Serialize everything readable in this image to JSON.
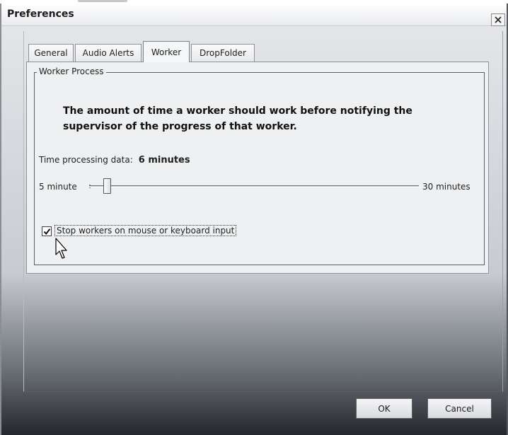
{
  "window": {
    "title": "Preferences"
  },
  "tabs": [
    {
      "label": "General",
      "active": false
    },
    {
      "label": "Audio Alerts",
      "active": false
    },
    {
      "label": "Worker",
      "active": true
    },
    {
      "label": "DropFolder",
      "active": false
    }
  ],
  "worker_process": {
    "group_label": "Worker Process",
    "description": "The amount of time a worker should work before notifying the supervisor of the progress of that worker.",
    "time_label": "Time processing data:",
    "time_value": "6 minutes",
    "slider": {
      "min_label": "5 minute",
      "max_label": "30 minutes",
      "min": 5,
      "max": 30,
      "value": 6
    },
    "stop_on_input": {
      "label": "Stop workers on mouse or keyboard input",
      "checked": true
    }
  },
  "buttons": {
    "ok": "OK",
    "cancel": "Cancel"
  },
  "icons": {
    "close": "close-icon",
    "check": "check-icon",
    "cursor": "mouse-pointer-icon"
  }
}
